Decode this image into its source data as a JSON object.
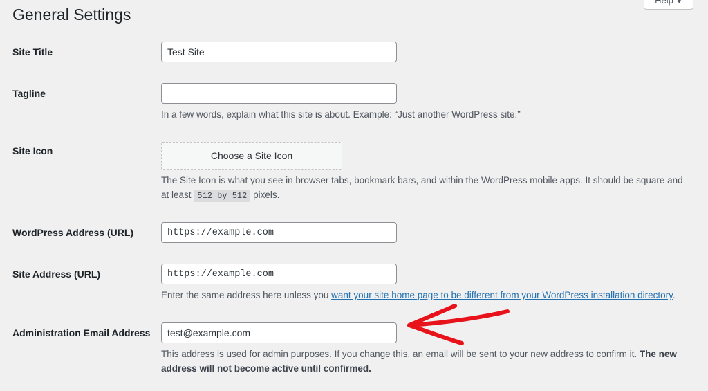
{
  "page": {
    "title": "General Settings",
    "help_label": "Help",
    "help_caret": "▼"
  },
  "settings": {
    "site_title": {
      "label": "Site Title",
      "value": "Test Site"
    },
    "tagline": {
      "label": "Tagline",
      "value": "",
      "description": "In a few words, explain what this site is about. Example: “Just another WordPress site.”"
    },
    "site_icon": {
      "label": "Site Icon",
      "button_label": "Choose a Site Icon",
      "description_line1": "The Site Icon is what you see in browser tabs, bookmark bars, and within the WordPress mobile apps. It should be square and",
      "description_pre": "at least",
      "description_code": "512 by 512",
      "description_post": "pixels."
    },
    "wordpress_address": {
      "label": "WordPress Address (URL)",
      "value": "https://example.com"
    },
    "site_address": {
      "label": "Site Address (URL)",
      "value": "https://example.com",
      "description_pre": "Enter the same address here unless you",
      "description_link": "want your site home page to be different from your WordPress installation directory",
      "description_post": "."
    },
    "admin_email": {
      "label": "Administration Email Address",
      "value": "test@example.com",
      "description_line1": "This address is used for admin purposes. If you change this, an email will be sent to your new address to confirm it.",
      "description_bold1": "The new",
      "description_bold2": "address will not become active until confirmed."
    }
  },
  "annotation": {
    "arrow_color": "#e8121a",
    "arrow_icon": "hand-drawn-arrow-icon"
  },
  "colors": {
    "background": "#f0f0f1",
    "link": "#2271b1",
    "text": "#1d2327",
    "description": "#50575e"
  }
}
